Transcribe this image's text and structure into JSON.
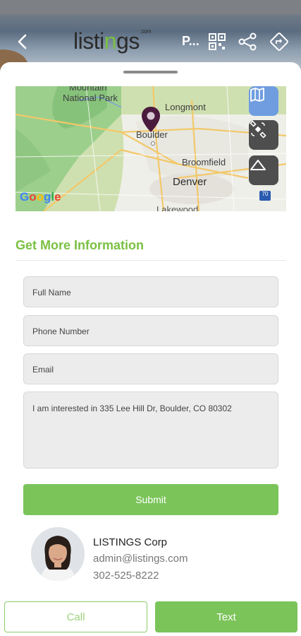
{
  "header": {
    "logo_text_pre": "listi",
    "logo_text_g": "n",
    "logo_text_post": "gs",
    "logo_suffix": ".com",
    "p_label": "P..."
  },
  "map": {
    "labels": {
      "mountain": "Mountain",
      "national_park": "National Park",
      "longmont": "Longmont",
      "boulder": "Boulder",
      "broomfield": "Broomfield",
      "denver": "Denver",
      "lakewood": "Lakewood",
      "highway": "70"
    },
    "google": [
      "G",
      "o",
      "o",
      "g",
      "l",
      "e"
    ],
    "google_colors": [
      "#4285F4",
      "#EA4335",
      "#FBBC05",
      "#4285F4",
      "#34A853",
      "#EA4335"
    ],
    "pin_color": "#4a1b3d"
  },
  "form": {
    "title": "Get More Information",
    "full_name_placeholder": "Full Name",
    "phone_placeholder": "Phone Number",
    "email_placeholder": "Email",
    "message_value": "I am interested in 335 Lee Hill Dr, Boulder, CO 80302",
    "submit_label": "Submit"
  },
  "agent": {
    "name": "LISTINGS Corp",
    "email": "admin@listings.com",
    "phone": "302-525-8222"
  },
  "actions": {
    "call_label": "Call",
    "text_label": "Text"
  },
  "colors": {
    "accent": "#7bc043",
    "button_green": "#7bc45a"
  }
}
